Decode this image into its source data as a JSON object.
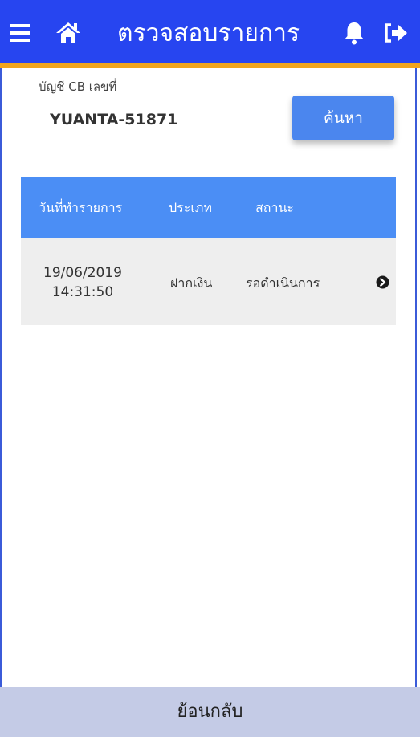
{
  "header": {
    "title": "ตรวจสอบรายการ",
    "background": "#2745f0",
    "accent_underline": "#f0a51e",
    "icons": [
      "menu-icon",
      "home-icon",
      "bell-icon",
      "logout-icon"
    ]
  },
  "search": {
    "label": "บัญชี CB เลขที่",
    "value": "YUANTA-51871",
    "button_label": "ค้นหา"
  },
  "table": {
    "header_color": "#4b8ef5",
    "columns": [
      "วันที่ทำรายการ",
      "ประเภท",
      "สถานะ"
    ],
    "rows": [
      {
        "date": "19/06/2019",
        "time": "14:31:50",
        "type": "ฝากเงิน",
        "status": "รอดำเนินการ",
        "action_icon": "chevron-right-circle-icon"
      }
    ]
  },
  "footer": {
    "back_label": "ย้อนกลับ",
    "background": "#c4cbe6"
  }
}
